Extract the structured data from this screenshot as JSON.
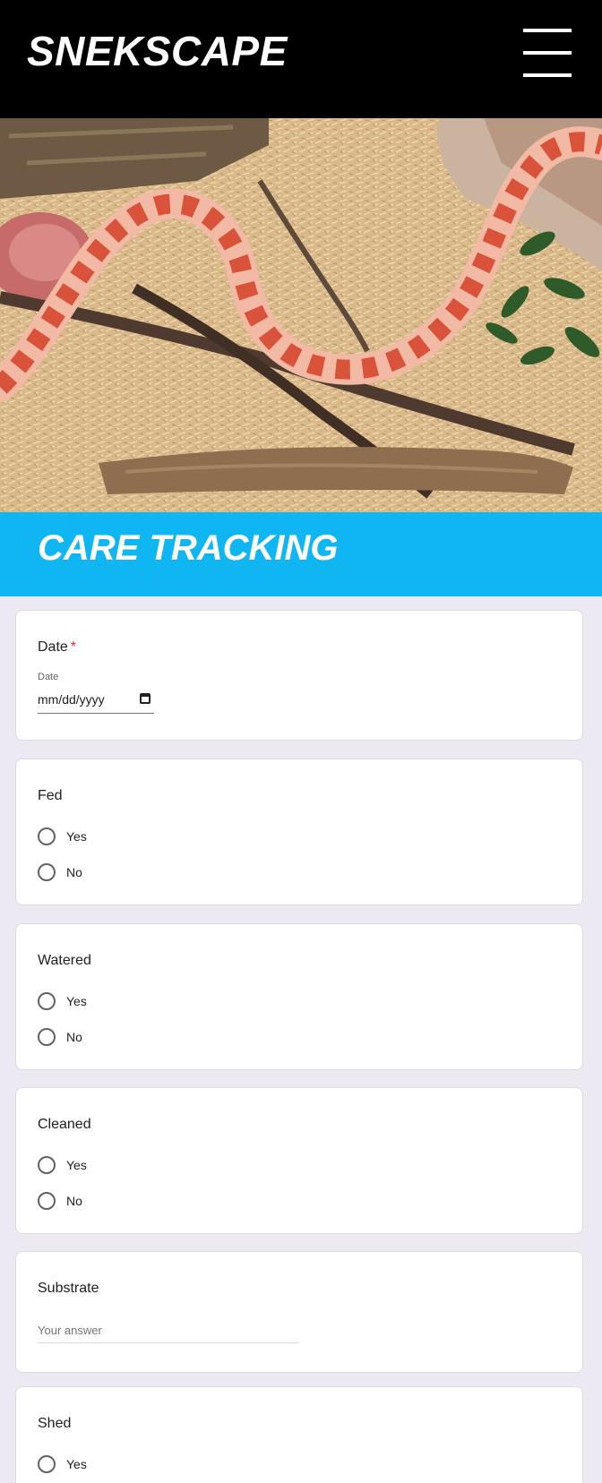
{
  "header": {
    "brand": "SNEKSCAPE",
    "menu_icon": "hamburger-menu-icon"
  },
  "hero": {
    "image": "corn-snake-enclosure-photo"
  },
  "banner": {
    "title": "CARE TRACKING"
  },
  "form": {
    "date": {
      "label": "Date",
      "required_mark": "*",
      "sub_label": "Date",
      "placeholder": "mm/dd/yyyy",
      "icon": "calendar-icon"
    },
    "fed": {
      "label": "Fed",
      "options": [
        "Yes",
        "No"
      ]
    },
    "watered": {
      "label": "Watered",
      "options": [
        "Yes",
        "No"
      ]
    },
    "cleaned": {
      "label": "Cleaned",
      "options": [
        "Yes",
        "No"
      ]
    },
    "substrate": {
      "label": "Substrate",
      "placeholder": "Your answer"
    },
    "shed": {
      "label": "Shed",
      "options": [
        "Yes"
      ]
    }
  },
  "colors": {
    "header_bg": "#000000",
    "banner_bg": "#10b6f2",
    "page_bg": "#ece9f3",
    "required": "#d93025"
  }
}
